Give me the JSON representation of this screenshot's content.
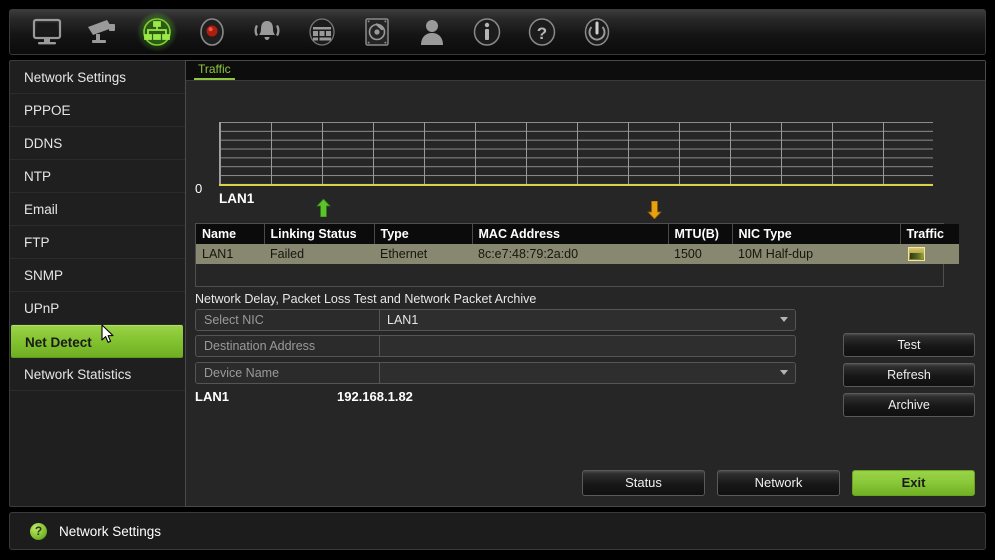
{
  "toolbar": {
    "icons": [
      {
        "name": "monitor-icon",
        "label": "Display",
        "active": false
      },
      {
        "name": "camera-icon",
        "label": "Camera",
        "active": false
      },
      {
        "name": "network-icon",
        "label": "Network",
        "active": true
      },
      {
        "name": "record-icon",
        "label": "Record",
        "active": false
      },
      {
        "name": "alarm-icon",
        "label": "Alarm",
        "active": false
      },
      {
        "name": "schedule-icon",
        "label": "Schedule",
        "active": false
      },
      {
        "name": "hdd-icon",
        "label": "HDD",
        "active": false
      },
      {
        "name": "user-icon",
        "label": "User",
        "active": false
      },
      {
        "name": "info-icon",
        "label": "Information",
        "active": false
      },
      {
        "name": "help-icon",
        "label": "Help",
        "active": false
      },
      {
        "name": "power-icon",
        "label": "Shutdown",
        "active": false
      }
    ]
  },
  "sidebar": {
    "items": [
      {
        "label": "Network Settings",
        "selected": false
      },
      {
        "label": "PPPOE",
        "selected": false
      },
      {
        "label": "DDNS",
        "selected": false
      },
      {
        "label": "NTP",
        "selected": false
      },
      {
        "label": "Email",
        "selected": false
      },
      {
        "label": "FTP",
        "selected": false
      },
      {
        "label": "SNMP",
        "selected": false
      },
      {
        "label": "UPnP",
        "selected": false
      },
      {
        "label": "Net Detect",
        "selected": true
      },
      {
        "label": "Network Statistics",
        "selected": false
      }
    ]
  },
  "main": {
    "tab_label": "Traffic"
  },
  "chart_data": {
    "type": "line",
    "title": "Traffic",
    "series": [
      {
        "name": "LAN1",
        "values": [
          0,
          0,
          0,
          0,
          0,
          0,
          0,
          0,
          0,
          0,
          0,
          0,
          0,
          0,
          0
        ]
      }
    ],
    "x": [
      0,
      1,
      2,
      3,
      4,
      5,
      6,
      7,
      8,
      9,
      10,
      11,
      12,
      13,
      14
    ],
    "ytick_labels": [
      "0"
    ],
    "ylim": [
      0,
      7
    ],
    "grid": true,
    "xlabel": "",
    "ylabel": "",
    "legend": "none",
    "series_label": "LAN1",
    "markers": [
      {
        "name": "upload-arrow",
        "direction": "up",
        "color": "#5ec22c"
      },
      {
        "name": "download-arrow",
        "direction": "down",
        "color": "#e8a010"
      }
    ],
    "axis_color": "#d9d24a"
  },
  "nic_table": {
    "headers": [
      "Name",
      "Linking Status",
      "Type",
      "MAC Address",
      "MTU(B)",
      "NIC Type",
      "Traffic"
    ],
    "rows": [
      {
        "name": "LAN1",
        "linking_status": "Failed",
        "type": "Ethernet",
        "mac_address": "8c:e7:48:79:2a:d0",
        "mtu": "1500",
        "nic_type": "10M Half-dup",
        "traffic_icon": "traffic-chart-icon"
      }
    ]
  },
  "test_section": {
    "title": "Network Delay, Packet Loss Test and Network Packet Archive",
    "fields": [
      {
        "label": "Select NIC",
        "value": "LAN1",
        "type": "select"
      },
      {
        "label": "Destination Address",
        "value": "",
        "type": "text"
      },
      {
        "label": "Device Name",
        "value": "",
        "type": "select"
      }
    ],
    "ip_row": {
      "nic": "LAN1",
      "address": "192.168.1.82"
    },
    "buttons": [
      {
        "label": "Test"
      },
      {
        "label": "Refresh"
      },
      {
        "label": "Archive"
      }
    ]
  },
  "footer_buttons": [
    {
      "label": "Status",
      "primary": false
    },
    {
      "label": "Network",
      "primary": false
    },
    {
      "label": "Exit",
      "primary": true
    }
  ],
  "statusbar": {
    "icon": "help-circle-icon",
    "icon_glyph": "?",
    "text": "Network Settings"
  },
  "colors": {
    "accent_green": "#8ac93a",
    "axis_yellow": "#d9d24a",
    "table_row": "#888871",
    "upload_arrow": "#5ec22c",
    "download_arrow": "#e8a010"
  }
}
